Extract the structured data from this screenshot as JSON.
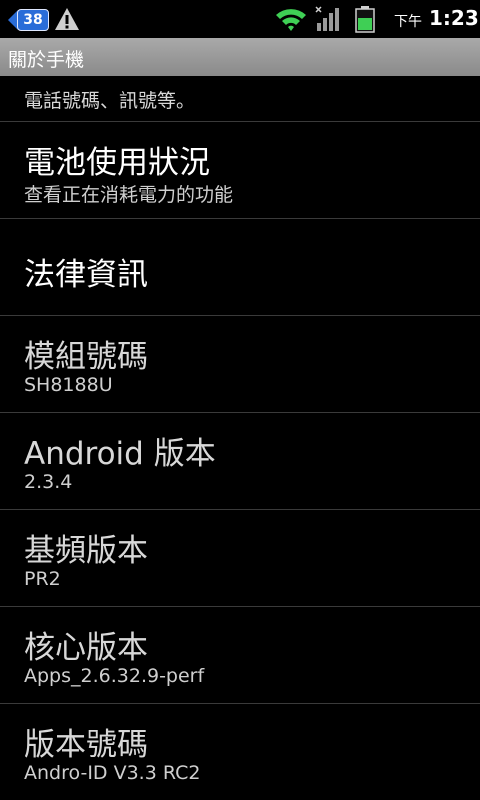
{
  "status_bar": {
    "notification_count": "38",
    "ampm": "下午",
    "time": "1:23"
  },
  "titlebar": {
    "title": "關於手機"
  },
  "list": {
    "partial_summary": "電話號碼、訊號等。",
    "items": [
      {
        "title": "電池使用狀況",
        "summary": "查看正在消耗電力的功能"
      },
      {
        "title": "法律資訊",
        "summary": ""
      },
      {
        "title": "模組號碼",
        "summary": "SH8188U"
      },
      {
        "title": "Android 版本",
        "summary": "2.3.4"
      },
      {
        "title": "基頻版本",
        "summary": "PR2"
      },
      {
        "title": "核心版本",
        "summary": "Apps_2.6.32.9-perf"
      },
      {
        "title": "版本號碼",
        "summary": "Andro-ID V3.3 RC2"
      }
    ]
  },
  "colors": {
    "background": "#000000",
    "titlebar": "#9a9a9a",
    "divider": "#3a3a3a",
    "wifi": "#3fcf55",
    "battery": "#3fcf55",
    "badge": "#2a6dd8"
  },
  "icons": [
    "notification-badge-icon",
    "warning-icon",
    "wifi-icon",
    "signal-icon",
    "battery-icon"
  ]
}
